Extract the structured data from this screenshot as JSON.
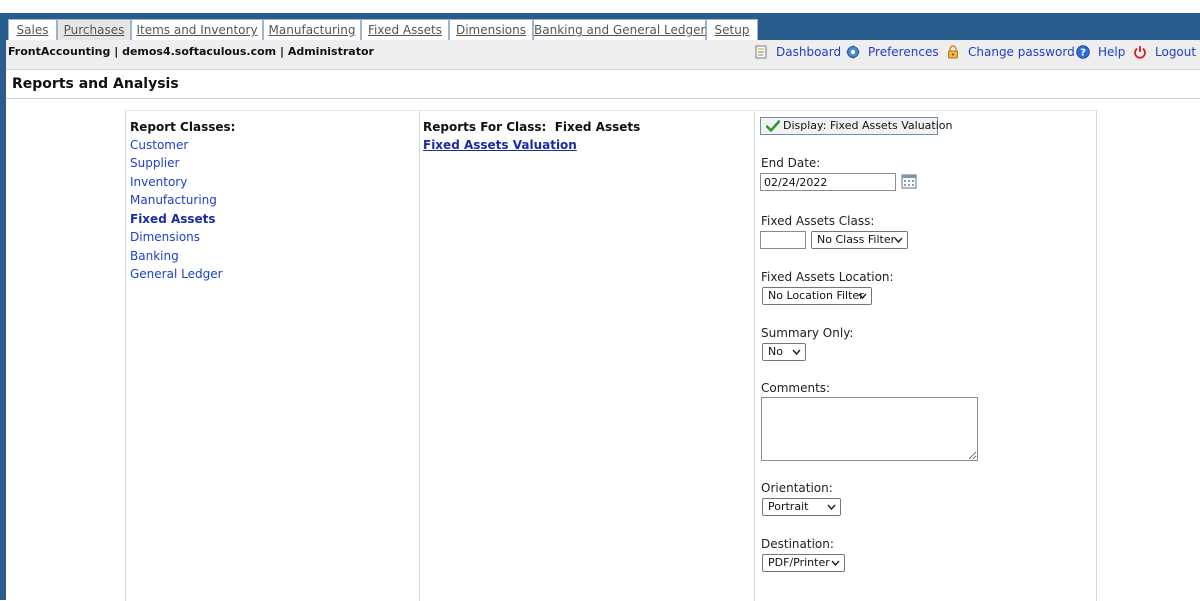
{
  "tabs": [
    "Sales",
    "Purchases",
    "Items and Inventory",
    "Manufacturing",
    "Fixed Assets",
    "Dimensions",
    "Banking and General Ledger",
    "Setup"
  ],
  "header": {
    "system_info": "FrontAccounting | demos4.softaculous.com | Administrator",
    "links": {
      "dashboard": "Dashboard",
      "preferences": "Preferences",
      "change_password": "Change password",
      "help": "Help",
      "logout": "Logout"
    }
  },
  "page_title": "Reports and Analysis",
  "report_classes": {
    "heading": "Report Classes:",
    "items": [
      "Customer",
      "Supplier",
      "Inventory",
      "Manufacturing",
      "Fixed Assets",
      "Dimensions",
      "Banking",
      "General Ledger"
    ],
    "selected": "Fixed Assets"
  },
  "reports": {
    "heading": "Reports For Class:  Fixed Assets",
    "items": [
      "Fixed Assets Valuation"
    ]
  },
  "form": {
    "display_button": "Display: Fixed Assets Valuation",
    "end_date_label": "End Date:",
    "end_date_value": "02/24/2022",
    "class_label": "Fixed Assets Class:",
    "class_code_value": "",
    "class_filter": "No Class Filter",
    "location_label": "Fixed Assets Location:",
    "location_filter": "No Location Filter",
    "summary_label": "Summary Only:",
    "summary_value": "No",
    "comments_label": "Comments:",
    "comments_value": "",
    "orientation_label": "Orientation:",
    "orientation_value": "Portrait",
    "destination_label": "Destination:",
    "destination_value": "PDF/Printer"
  },
  "colors": {
    "nav_bar": "#2a5d8e",
    "link": "#1e40c8",
    "selected_link": "#1a2aa0",
    "header_bg": "#eeeeee"
  },
  "icons": {
    "dashboard": "document-icon",
    "preferences": "gear-icon",
    "change_password": "lock-icon",
    "help": "help-icon",
    "logout": "power-icon",
    "display": "checkmark-icon",
    "calendar": "calendar-icon"
  }
}
